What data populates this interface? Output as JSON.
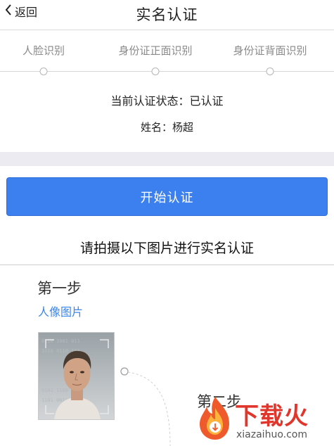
{
  "header": {
    "back_label": "返回",
    "title": "实名认证"
  },
  "steps": [
    {
      "label": "人脸识别"
    },
    {
      "label": "身份证正面识别"
    },
    {
      "label": "身份证背面识别"
    }
  ],
  "status": {
    "text": "当前认证状态：已认证",
    "name": "姓名：杨超"
  },
  "start_button": {
    "label": "开始认证",
    "color": "#3c80f0"
  },
  "instruction": "请拍摄以下图片进行实名认证",
  "step1": {
    "title": "第一步",
    "subtitle": "人像图片",
    "subtitle_color": "#3a86ee",
    "photo_icon": "portrait-photo"
  },
  "step2": {
    "title": "第二步"
  },
  "watermark": {
    "logo_icon": "flame-download-icon",
    "text": "下载火",
    "sub": "xiazaihuo.com",
    "color": "#e0362c"
  }
}
